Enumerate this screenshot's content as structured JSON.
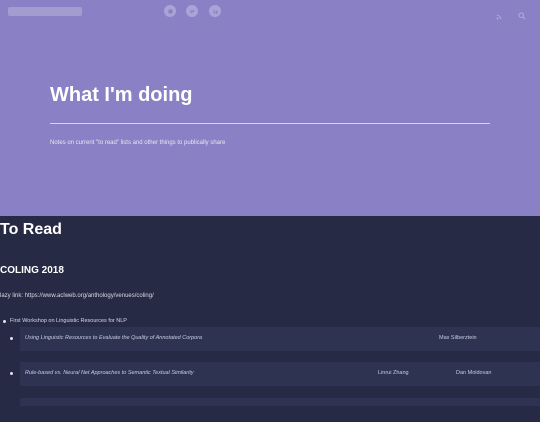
{
  "header": {
    "nav": [
      "",
      "",
      ""
    ],
    "social_icons": [
      "github-icon",
      "twitter-icon",
      "linkedin-icon"
    ],
    "right_icons": [
      "rss-icon",
      "search-icon"
    ]
  },
  "hero": {
    "title": "What I'm doing",
    "subtitle": "Notes on current \"to read\" lists and other things to publically share"
  },
  "content": {
    "section_title": "To Read",
    "conference_title": "COLING 2018",
    "lazy_link": "lazy link: https://www.aclweb.org/anthology/venues/coling/",
    "workshop": "First Workshop on Linguistic Resources for NLP",
    "papers": [
      {
        "title": "Using Linguistic Resources to Evaluate the Quality of Annotated Corpora",
        "authors": [
          "Max Silberztein"
        ]
      },
      {
        "title": "Rule-based vs. Neural Net Approaches to Semantic Textual Similarity",
        "authors": [
          "Linrui Zhang",
          "Dan Moldovan"
        ]
      }
    ]
  },
  "colors": {
    "hero_bg": "#8a80c5",
    "page_bg": "#262a45",
    "row_bg": "#2e3352"
  }
}
